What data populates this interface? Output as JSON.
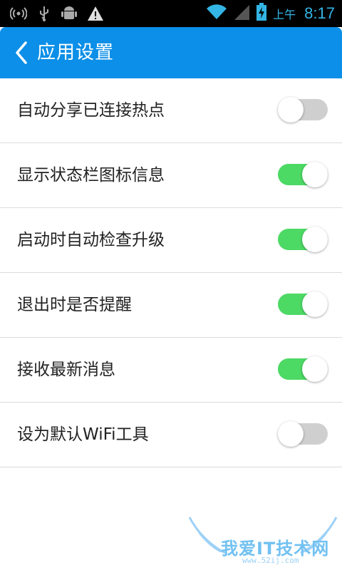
{
  "status_bar": {
    "time": "8:17",
    "ampm": "上午",
    "icons": [
      "hotspot-icon",
      "usb-icon",
      "android-debug-icon",
      "warning-icon",
      "wifi-icon",
      "signal-icon",
      "battery-charging-icon"
    ]
  },
  "app_bar": {
    "title": "应用设置",
    "back_icon": "chevron-left-icon",
    "color": "#0b8fe8"
  },
  "settings": [
    {
      "label": "自动分享已连接热点",
      "enabled": false
    },
    {
      "label": "显示状态栏图标信息",
      "enabled": true
    },
    {
      "label": "启动时自动检查升级",
      "enabled": true
    },
    {
      "label": "退出时是否提醒",
      "enabled": true
    },
    {
      "label": "接收最新消息",
      "enabled": true
    },
    {
      "label": "设为默认WiFi工具",
      "enabled": false
    }
  ],
  "watermark": {
    "text": "我爱IT技术网",
    "sub": "www.52ij.com"
  },
  "colors": {
    "toggle_on": "#4cd964",
    "toggle_off": "#cfcfcf",
    "accent": "#33b5e5"
  }
}
